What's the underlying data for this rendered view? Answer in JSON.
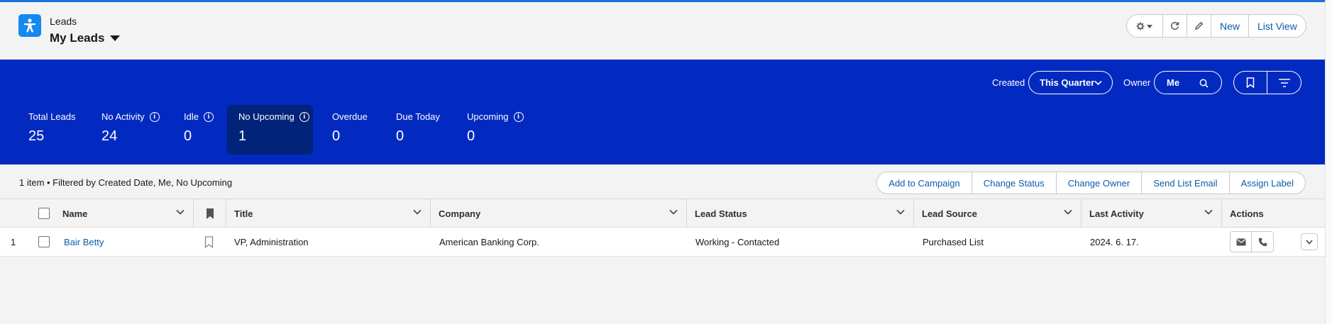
{
  "header": {
    "object_label": "Leads",
    "list_title": "My Leads",
    "buttons": {
      "new": "New",
      "list_view": "List View"
    }
  },
  "filters": {
    "created_label": "Created",
    "created_value": "This Quarter",
    "owner_label": "Owner",
    "owner_value": "Me"
  },
  "metrics": [
    {
      "label": "Total Leads",
      "value": "25",
      "info": false
    },
    {
      "label": "No Activity",
      "value": "24",
      "info": true
    },
    {
      "label": "Idle",
      "value": "0",
      "info": true
    },
    {
      "label": "No Upcoming",
      "value": "1",
      "info": true,
      "selected": true
    },
    {
      "label": "Overdue",
      "value": "0",
      "info": false
    },
    {
      "label": "Due Today",
      "value": "0",
      "info": false
    },
    {
      "label": "Upcoming",
      "value": "0",
      "info": true
    }
  ],
  "toolbar": {
    "summary": "1 item • Filtered by Created Date, Me, No Upcoming",
    "actions": [
      "Add to Campaign",
      "Change Status",
      "Change Owner",
      "Send List Email",
      "Assign Label"
    ]
  },
  "table": {
    "columns": {
      "name": "Name",
      "title": "Title",
      "company": "Company",
      "lead_status": "Lead Status",
      "lead_source": "Lead Source",
      "last_activity": "Last Activity",
      "actions": "Actions"
    },
    "rows": [
      {
        "index": "1",
        "name": "Bair Betty",
        "title": "VP, Administration",
        "company": "American Banking Corp.",
        "lead_status": "Working - Contacted",
        "lead_source": "Purchased List",
        "last_activity": "2024. 6. 17."
      }
    ]
  },
  "colors": {
    "band": "#022ac0",
    "selected_metric": "#01237a",
    "link": "#0b5cab",
    "object_icon": "#1589ee"
  }
}
